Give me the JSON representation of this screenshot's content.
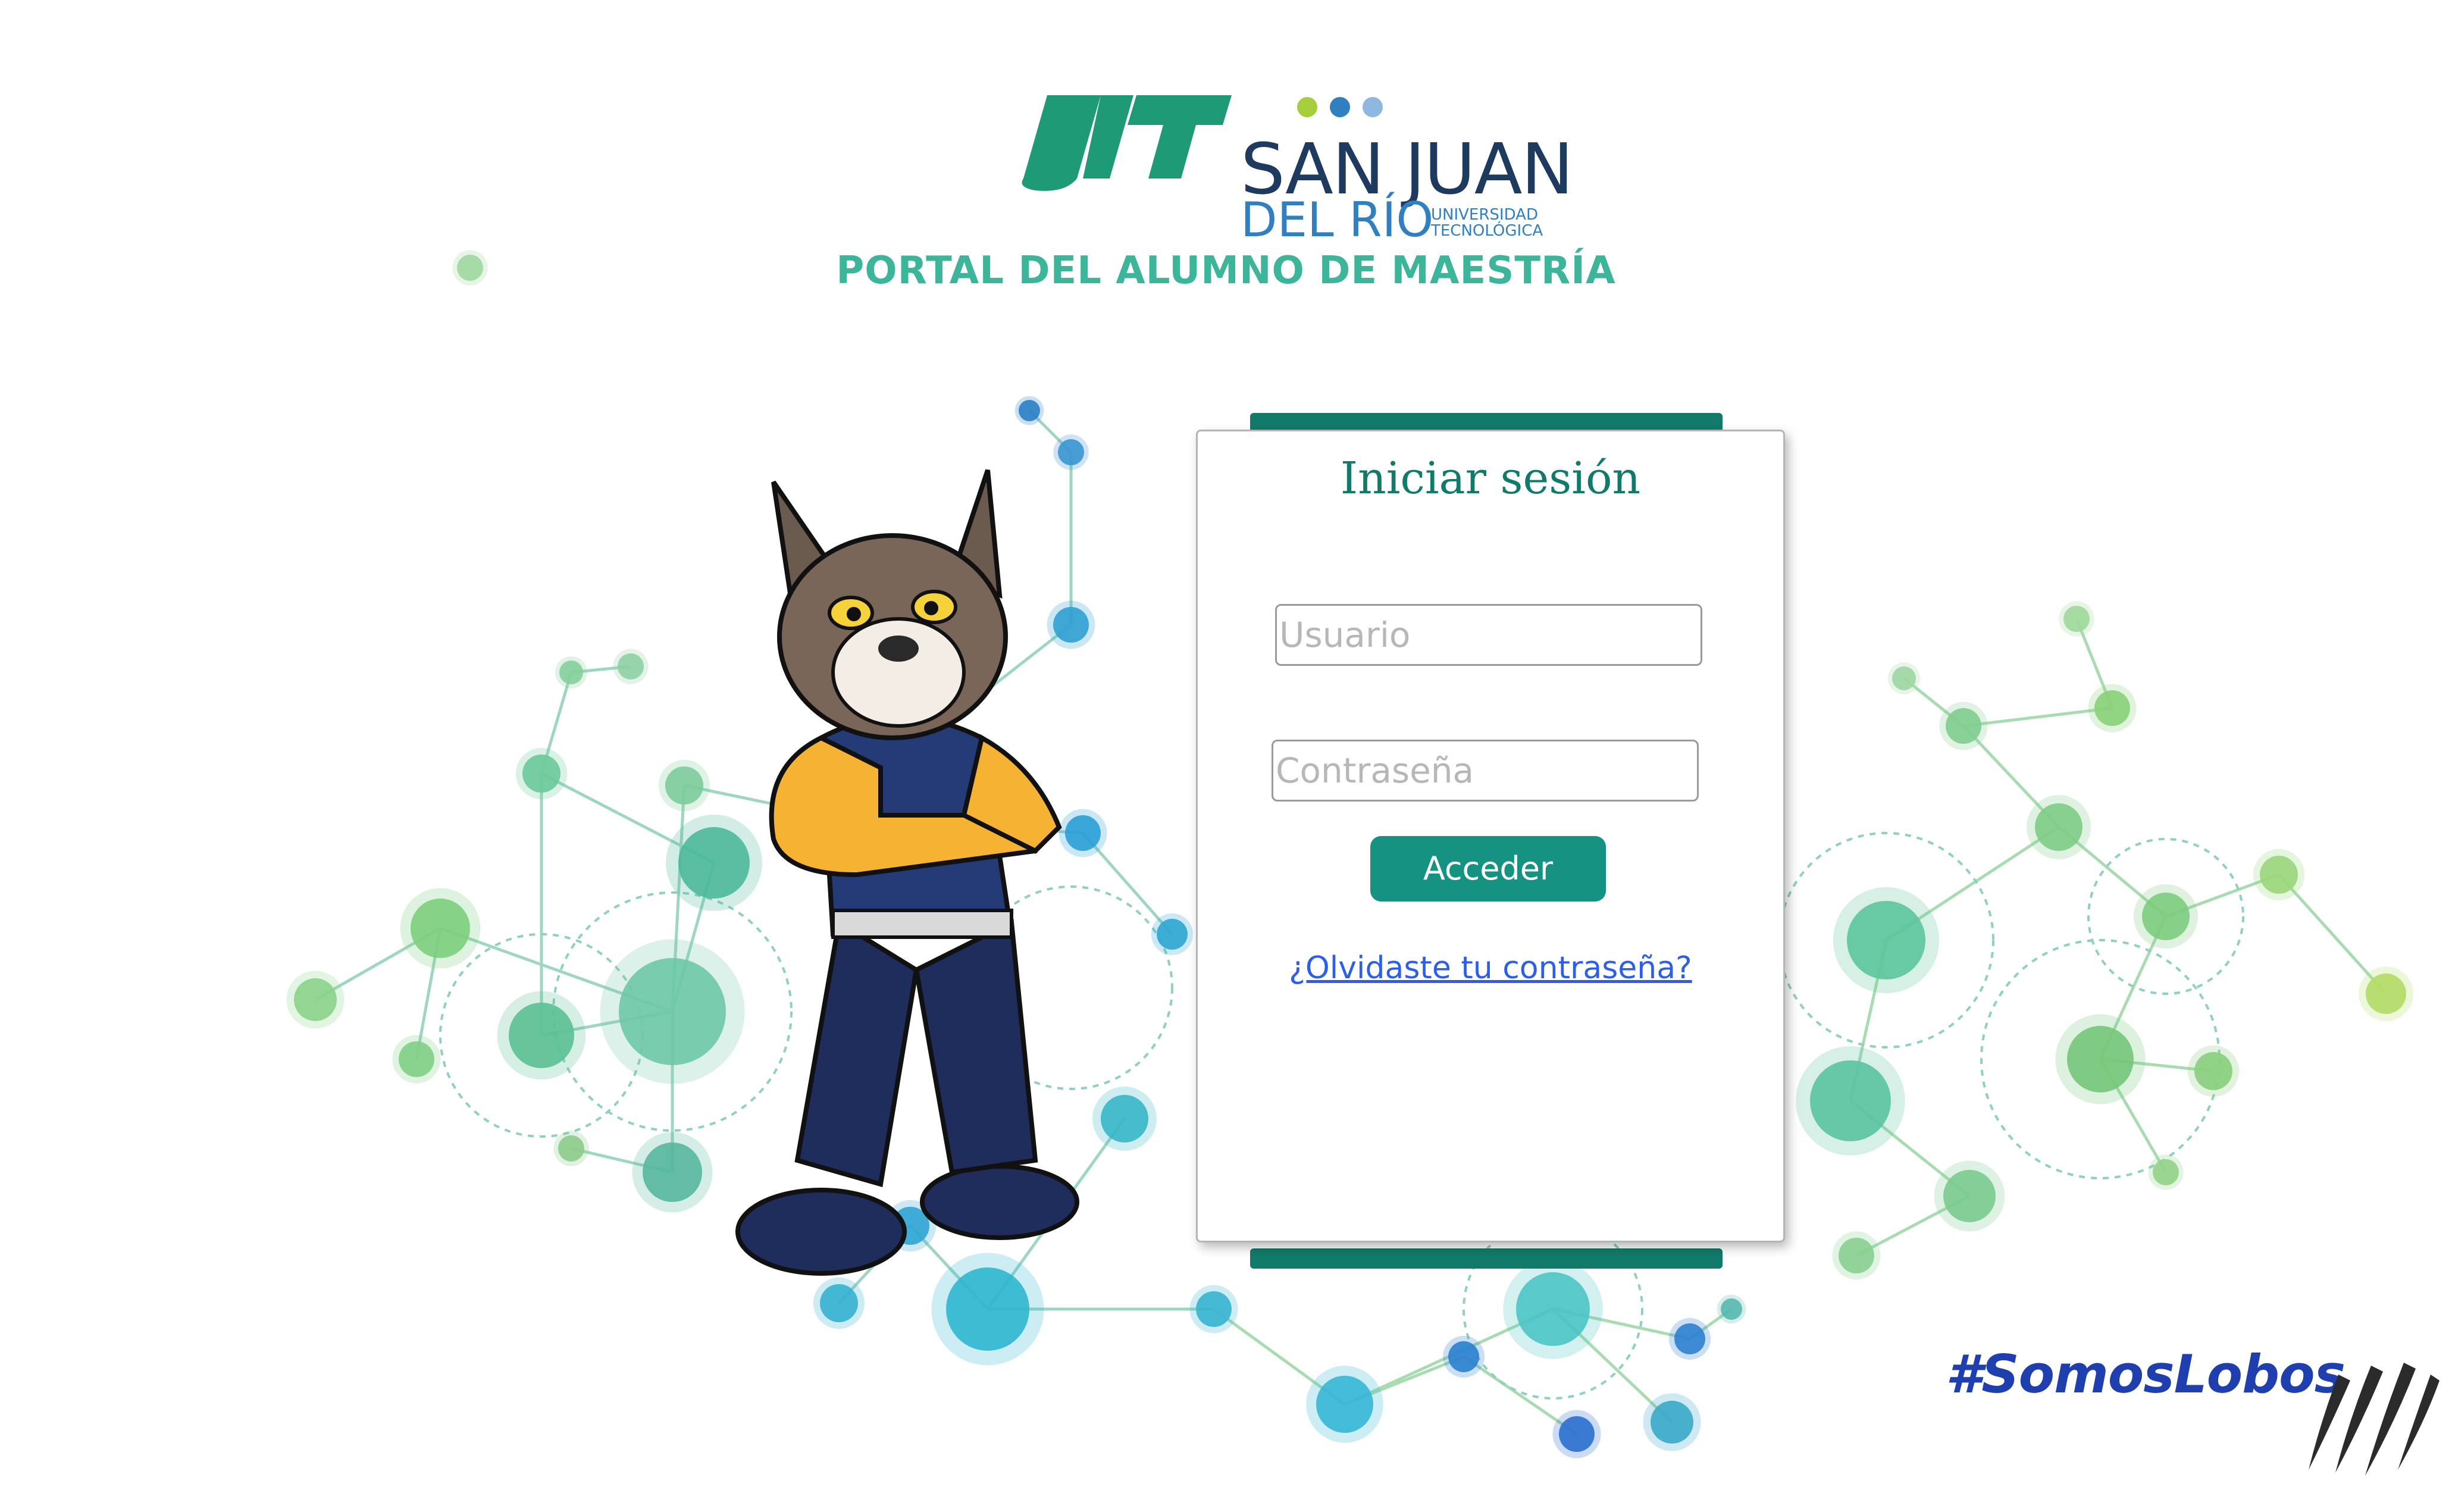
{
  "brand": {
    "logo_mark": "UT",
    "name_line1": "SAN JUAN",
    "name_line2": "DEL RÍO",
    "tagline_line1": "UNIVERSIDAD",
    "tagline_line2": "TECNOLÓGICA",
    "dot_colors": [
      "#a4cf3b",
      "#2f7fc1",
      "#8fb8e0"
    ],
    "mark_color": "#1f9a77"
  },
  "page": {
    "title": "PORTAL DEL ALUMNO DE MAESTRÍA"
  },
  "login": {
    "heading": "Iniciar sesión",
    "username": {
      "value": "",
      "placeholder": "Usuario"
    },
    "password": {
      "value": "",
      "placeholder": "Contraseña"
    },
    "submit_label": "Acceder",
    "forgot_link": "¿Olvidaste tu contraseña?"
  },
  "footer": {
    "hashtag": "#SomosLobos"
  },
  "colors": {
    "accent": "#169283",
    "accent_dark": "#127a6a",
    "title_green": "#3cb59b",
    "link_blue": "#2d5ee8",
    "hashtag_blue": "#1f3fae"
  },
  "icons": {
    "mascot": "wolf-mascot-illustration",
    "claw": "claw-marks-icon",
    "background": "network-nodes-graphic"
  }
}
